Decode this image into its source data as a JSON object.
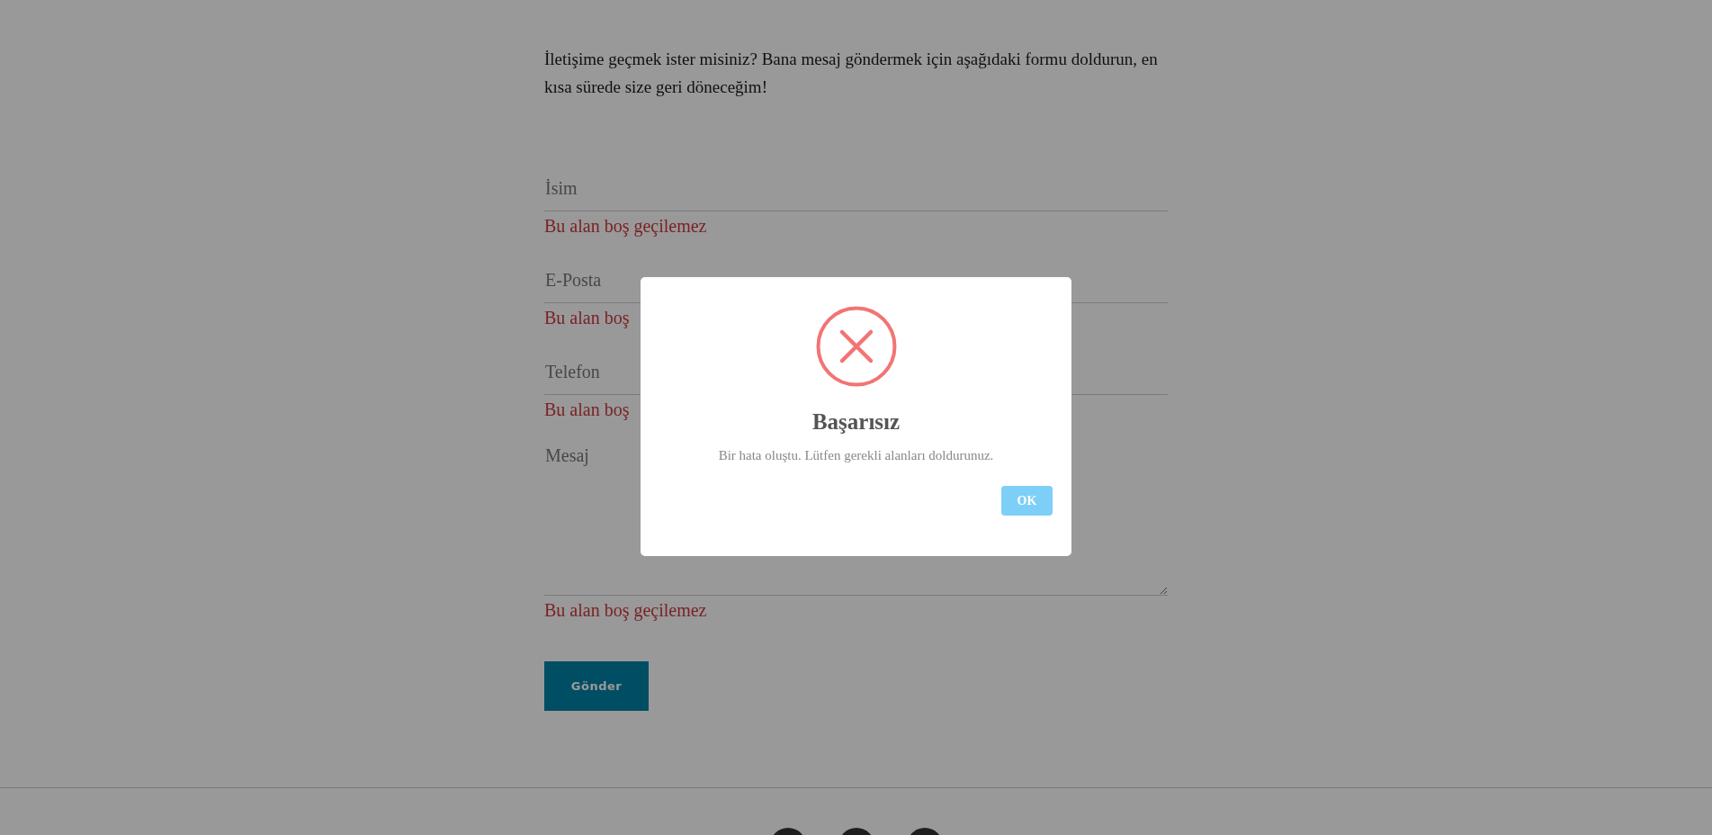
{
  "intro": "İletişime geçmek ister misiniz? Bana mesaj göndermek için aşağıdaki formu doldurun, en kısa sürede size geri döneceğim!",
  "fields": [
    {
      "kind": "input",
      "placeholder": "İsim",
      "error": "Bu alan boş geçilemez"
    },
    {
      "kind": "input",
      "placeholder": "E-Posta",
      "error": "Bu alan boş"
    },
    {
      "kind": "input",
      "placeholder": "Telefon",
      "error": "Bu alan boş"
    },
    {
      "kind": "textarea",
      "placeholder": "Mesaj",
      "error": "Bu alan boş geçilemez"
    }
  ],
  "submit_button": "Gönder",
  "dialog": {
    "title": "Başarısız",
    "message": "Bir hata oluştu. Lütfen gerekli alanları doldurunuz.",
    "ok_button": "OK"
  }
}
